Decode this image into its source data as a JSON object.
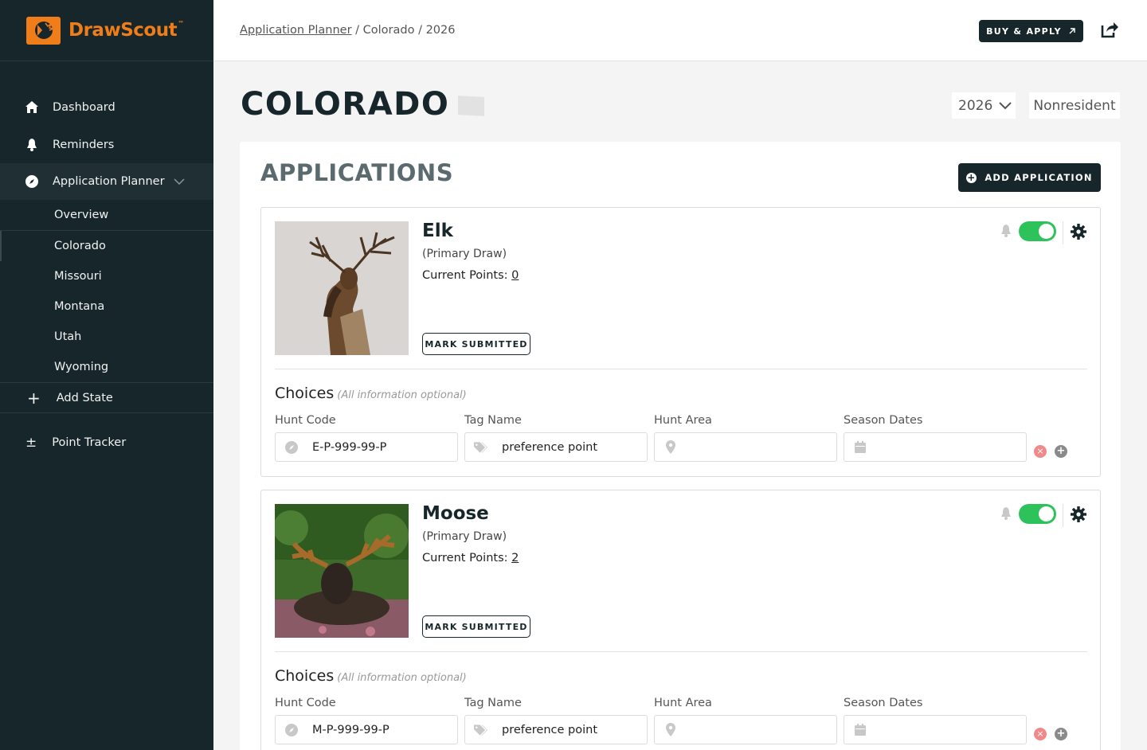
{
  "app": {
    "brand": "DrawScout",
    "trademark": "™"
  },
  "sidebar": {
    "nav": [
      {
        "label": "Dashboard",
        "icon": "home-icon"
      },
      {
        "label": "Reminders",
        "icon": "bell-icon"
      },
      {
        "label": "Application Planner",
        "icon": "compass-icon"
      }
    ],
    "planner_items": [
      "Overview",
      "Colorado",
      "Missouri",
      "Montana",
      "Utah",
      "Wyoming"
    ],
    "add_state": "Add State",
    "point_tracker": "Point Tracker"
  },
  "header": {
    "breadcrumb_link": "Application Planner",
    "breadcrumb_rest": " / Colorado / 2026",
    "buy_apply": "BUY & APPLY"
  },
  "page": {
    "state": "COLORADO",
    "year": "2026",
    "residency": "Nonresident",
    "section_title": "APPLICATIONS",
    "add_application": "ADD APPLICATION"
  },
  "applications": [
    {
      "species": "Elk",
      "draw_type": "(Primary Draw)",
      "points_label": "Current Points: ",
      "points": "0",
      "mark_submitted": "MARK SUBMITTED",
      "reminders_enabled": true,
      "choices_title": "Choices",
      "choices_note": "(All information optional)",
      "labels": {
        "hunt_code": "Hunt Code",
        "tag_name": "Tag Name",
        "hunt_area": "Hunt Area",
        "season_dates": "Season Dates"
      },
      "values": {
        "hunt_code": "E-P-999-99-P",
        "tag_name": "preference point",
        "hunt_area": "",
        "season_dates": ""
      }
    },
    {
      "species": "Moose",
      "draw_type": "(Primary Draw)",
      "points_label": "Current Points: ",
      "points": "2",
      "mark_submitted": "MARK SUBMITTED",
      "reminders_enabled": true,
      "choices_title": "Choices",
      "choices_note": "(All information optional)",
      "labels": {
        "hunt_code": "Hunt Code",
        "tag_name": "Tag Name",
        "hunt_area": "Hunt Area",
        "season_dates": "Season Dates"
      },
      "values": {
        "hunt_code": "M-P-999-99-P",
        "tag_name": "preference point",
        "hunt_area": "",
        "season_dates": ""
      }
    }
  ],
  "colors": {
    "sidebar_bg": "#16262b",
    "brand_orange": "#ef7d1a",
    "toggle_on": "#2ec25a"
  }
}
